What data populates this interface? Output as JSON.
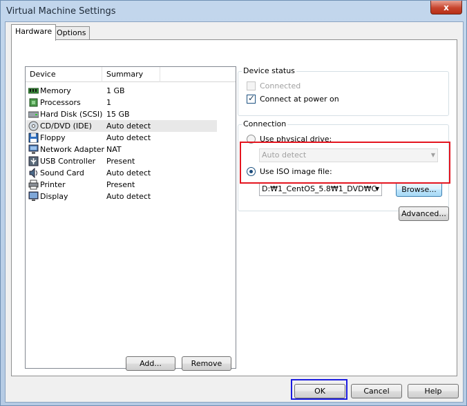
{
  "window": {
    "title": "Virtual Machine Settings",
    "close_glyph": "x"
  },
  "tabs": [
    {
      "label": "Hardware",
      "active": true
    },
    {
      "label": "Options",
      "active": false
    }
  ],
  "device_list": {
    "columns": [
      "Device",
      "Summary"
    ],
    "rows": [
      {
        "name": "Memory",
        "summary": "1 GB",
        "icon": "memory-icon"
      },
      {
        "name": "Processors",
        "summary": "1",
        "icon": "processor-icon"
      },
      {
        "name": "Hard Disk (SCSI)",
        "summary": "15 GB",
        "icon": "hard-disk-icon"
      },
      {
        "name": "CD/DVD (IDE)",
        "summary": "Auto detect",
        "icon": "cd-dvd-icon",
        "selected": true
      },
      {
        "name": "Floppy",
        "summary": "Auto detect",
        "icon": "floppy-icon"
      },
      {
        "name": "Network Adapter",
        "summary": "NAT",
        "icon": "network-adapter-icon"
      },
      {
        "name": "USB Controller",
        "summary": "Present",
        "icon": "usb-icon"
      },
      {
        "name": "Sound Card",
        "summary": "Auto detect",
        "icon": "sound-card-icon"
      },
      {
        "name": "Printer",
        "summary": "Present",
        "icon": "printer-icon"
      },
      {
        "name": "Display",
        "summary": "Auto detect",
        "icon": "display-icon"
      }
    ]
  },
  "list_buttons": {
    "add": "Add...",
    "remove": "Remove"
  },
  "device_status": {
    "label": "Device status",
    "connected": {
      "label": "Connected",
      "checked": false,
      "disabled": true
    },
    "connect_at_power_on": {
      "label": "Connect at power on",
      "checked": true
    }
  },
  "connection": {
    "label": "Connection",
    "use_physical_drive": {
      "label": "Use physical drive:",
      "selected": false
    },
    "physical_drive_value": "Auto detect",
    "use_iso": {
      "label": "Use ISO image file:",
      "selected": true
    },
    "iso_path": "D:₩1_CentOS_5.8₩1_DVD₩C",
    "browse": "Browse..."
  },
  "advanced_button": "Advanced...",
  "footer": {
    "ok": "OK",
    "cancel": "Cancel",
    "help": "Help"
  },
  "highlights": {
    "iso_box_color": "#e4141e",
    "ok_box_color": "#1a1ae0"
  }
}
